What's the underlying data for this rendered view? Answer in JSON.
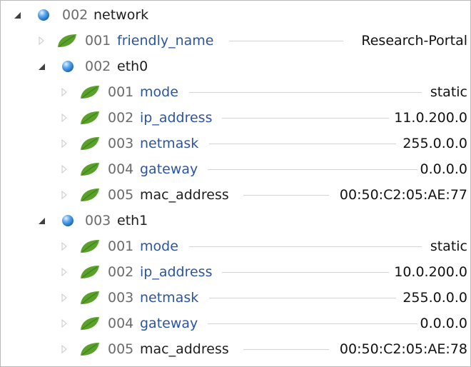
{
  "tree": {
    "root": {
      "index": "002",
      "name": "network"
    },
    "friendly_name": {
      "index": "001",
      "name": "friendly_name",
      "value": "Research-Portal"
    },
    "eth0": {
      "index": "002",
      "name": "eth0",
      "fields": [
        {
          "index": "001",
          "name": "mode",
          "value": "static"
        },
        {
          "index": "002",
          "name": "ip_address",
          "value": "11.0.200.0"
        },
        {
          "index": "003",
          "name": "netmask",
          "value": "255.0.0.0"
        },
        {
          "index": "004",
          "name": "gateway",
          "value": "0.0.0.0"
        },
        {
          "index": "005",
          "name": "mac_address",
          "value": "00:50:C2:05:AE:77"
        }
      ]
    },
    "eth1": {
      "index": "003",
      "name": "eth1",
      "fields": [
        {
          "index": "001",
          "name": "mode",
          "value": "static"
        },
        {
          "index": "002",
          "name": "ip_address",
          "value": "10.0.200.0"
        },
        {
          "index": "003",
          "name": "netmask",
          "value": "255.0.0.0"
        },
        {
          "index": "004",
          "name": "gateway",
          "value": "0.0.0.0"
        },
        {
          "index": "005",
          "name": "mac_address",
          "value": "00:50:C2:05:AE:78"
        }
      ]
    }
  },
  "colors": {
    "branch_label": "#1e1e1e",
    "leaf_label": "#2a55a4",
    "leaf_icon": "#5aa12a",
    "branch_icon": "#3f8edc"
  },
  "icons": {
    "expanded": "expanded-triangle-icon",
    "collapsed": "collapsed-triangle-icon",
    "branch": "blue-sphere-icon",
    "leaf": "green-leaf-icon"
  }
}
